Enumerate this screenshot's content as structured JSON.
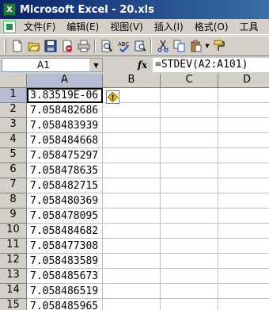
{
  "window": {
    "title": "Microsoft Excel - 20.xls",
    "logo_letter": "X"
  },
  "menu": {
    "items": [
      "文件(F)",
      "编辑(E)",
      "视图(V)",
      "插入(I)",
      "格式(O)",
      "工具"
    ]
  },
  "toolbar": {
    "buttons": [
      "new-icon",
      "open-icon",
      "save-icon",
      "permission-icon",
      "print-icon",
      "print-preview-icon",
      "spelling-icon",
      "research-icon",
      "cut-icon",
      "copy-icon",
      "paste-icon",
      "format-painter-icon"
    ]
  },
  "formula_bar": {
    "name_box": "A1",
    "fx_label": "fx",
    "formula": "=STDEV(A2:A101)"
  },
  "sheet": {
    "columns": [
      "A",
      "B",
      "C",
      "D"
    ],
    "rows": [
      "1",
      "2",
      "3",
      "4",
      "5",
      "6",
      "7",
      "8",
      "9",
      "10",
      "11",
      "12",
      "13",
      "14",
      "15"
    ],
    "col_a_values": [
      "3.83519E-06",
      "7.058482686",
      "7.058483939",
      "7.058484668",
      "7.058475297",
      "7.058478635",
      "7.058482715",
      "7.058480369",
      "7.058478095",
      "7.058484682",
      "7.058477308",
      "7.058483589",
      "7.058485673",
      "7.058486519",
      "7.058485965"
    ],
    "selected_cell": "A1",
    "error_indicator": "!"
  },
  "colors": {
    "title_bar": "#0a246a",
    "header_active": "#b6bdd2",
    "chrome": "#d4d0c8"
  }
}
